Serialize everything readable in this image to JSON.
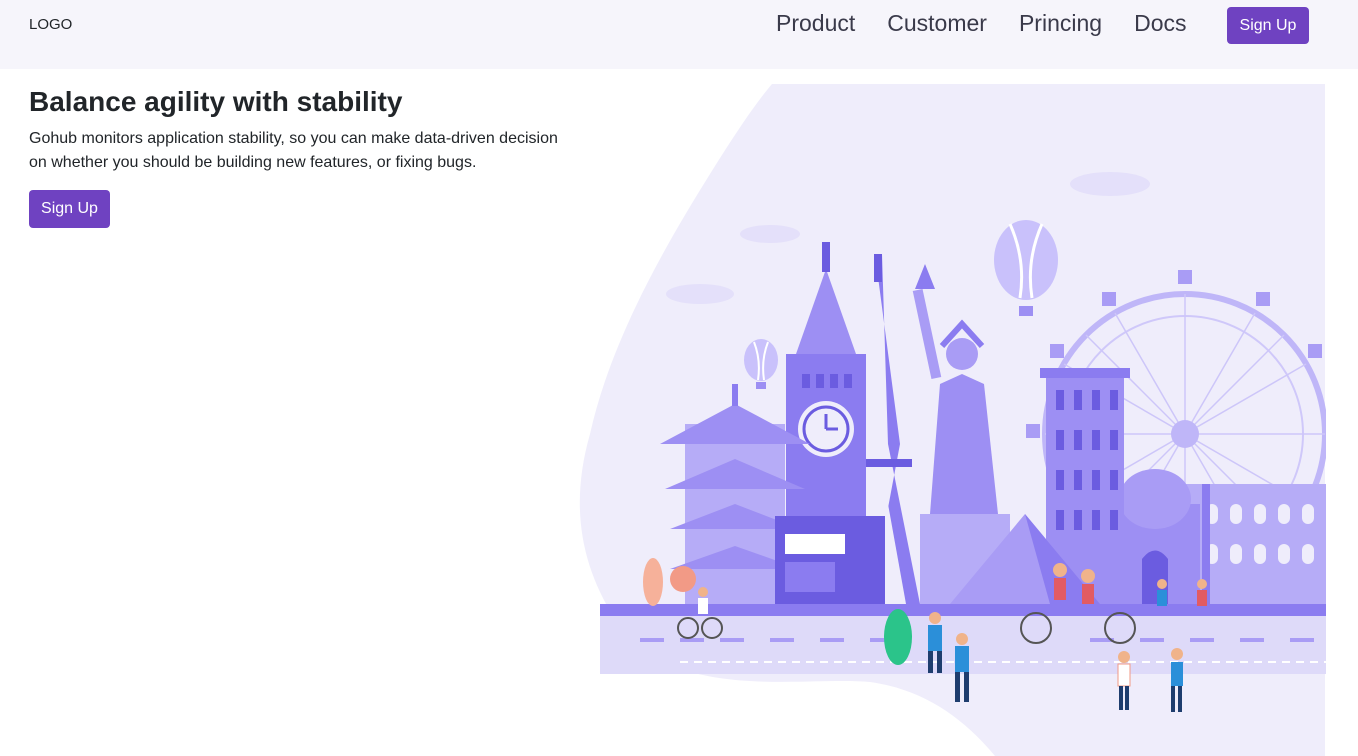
{
  "navbar": {
    "logo": "LOGO",
    "links": [
      "Product",
      "Customer",
      "Princing",
      "Docs"
    ],
    "signup_label": "Sign Up"
  },
  "hero": {
    "title": "Balance agility with stability",
    "description": "Gohub monitors application stability, so you can make data-driven decision on whether you should be building new features, or fixing bugs.",
    "signup_label": "Sign Up"
  },
  "colors": {
    "accent": "#6f42c1",
    "navbar_bg": "#f6f5fb",
    "illustration_primary": "#8b7cf0",
    "illustration_light": "#e9e6fb"
  },
  "illustration": {
    "icon": "city-landmarks-illustration"
  }
}
